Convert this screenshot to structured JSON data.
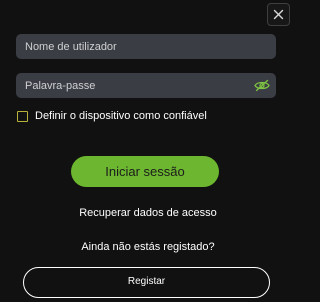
{
  "dialog": {
    "close_icon": "close-icon"
  },
  "form": {
    "username": {
      "placeholder": "Nome de utilizador",
      "value": ""
    },
    "password": {
      "placeholder": "Palavra-passe",
      "value": "",
      "toggle_icon": "eye-icon"
    },
    "trust_device": {
      "label": "Definir o dispositivo como confiável",
      "checked": false
    },
    "login_button": "Iniciar sessão",
    "recover_link": "Recuperar dados de acesso",
    "register_prompt": "Ainda não estás registado?",
    "register_button": "Registar"
  },
  "colors": {
    "background": "#111111",
    "input_background": "#3a3d44",
    "accent_green": "#6cb72f",
    "checkbox_border": "#b8b23a",
    "eye_icon": "#7dc242"
  }
}
